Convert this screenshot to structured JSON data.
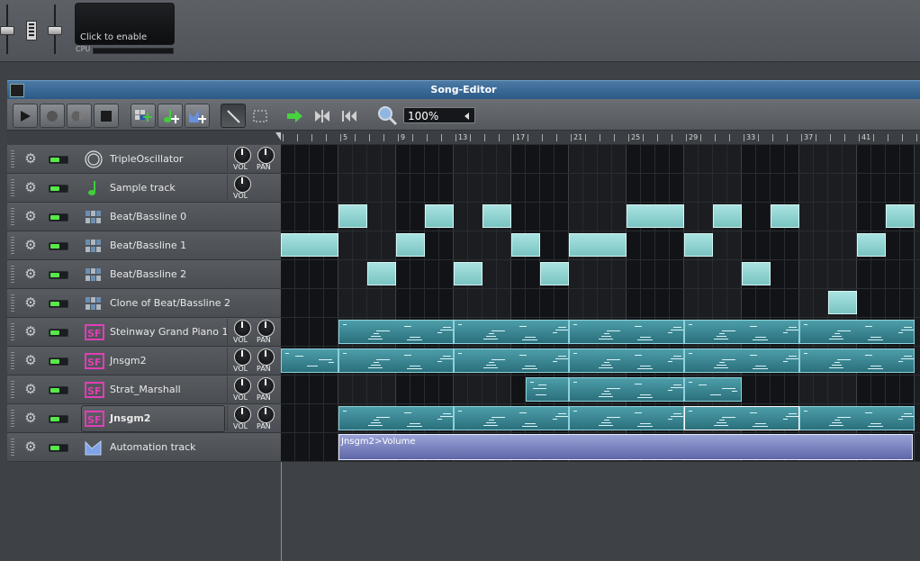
{
  "top": {
    "cpu_hint": "Click to enable",
    "cpu_label": "CPU"
  },
  "window": {
    "title": "Song-Editor",
    "zoom": "100%"
  },
  "ruler": {
    "labels": [
      "5",
      "9",
      "13",
      "17",
      "21",
      "25",
      "29",
      "33",
      "37",
      "41"
    ]
  },
  "tracks": [
    {
      "name": "TripleOscillator",
      "type": "instrument",
      "icon": "triple-oscillator-icon",
      "knobs": [
        "VOL",
        "PAN"
      ]
    },
    {
      "name": "Sample track",
      "type": "sample",
      "icon": "note-icon",
      "knobs": [
        "VOL"
      ]
    },
    {
      "name": "Beat/Bassline 0",
      "type": "beat",
      "icon": "beat-bassline-icon",
      "knobs": []
    },
    {
      "name": "Beat/Bassline 1",
      "type": "beat",
      "icon": "beat-bassline-icon",
      "knobs": []
    },
    {
      "name": "Beat/Bassline 2",
      "type": "beat",
      "icon": "beat-bassline-icon",
      "knobs": []
    },
    {
      "name": "Clone of Beat/Bassline 2",
      "type": "beat",
      "icon": "beat-bassline-icon",
      "knobs": []
    },
    {
      "name": "Steinway Grand Piano 1",
      "type": "instrument",
      "icon": "sf2-icon",
      "knobs": [
        "VOL",
        "PAN"
      ]
    },
    {
      "name": "Jnsgm2",
      "type": "instrument",
      "icon": "sf2-icon",
      "knobs": [
        "VOL",
        "PAN"
      ]
    },
    {
      "name": "Strat_Marshall",
      "type": "instrument",
      "icon": "sf2-icon",
      "knobs": [
        "VOL",
        "PAN"
      ]
    },
    {
      "name": "Jnsgm2",
      "type": "instrument",
      "icon": "sf2-icon",
      "knobs": [
        "VOL",
        "PAN"
      ],
      "selected": true
    },
    {
      "name": "Automation track",
      "type": "automation",
      "icon": "automation-icon",
      "knobs": []
    }
  ],
  "automation_clip_label": "Jnsgm2>Volume",
  "colors": {
    "titlebar": "#2b5a88",
    "mute_on": "#58e84a",
    "beat_clip": "#a9e3e1",
    "pattern_clip": "#2a6f7c",
    "automation_clip": "#5e66a8",
    "sf2_icon": "#e03fb5"
  }
}
